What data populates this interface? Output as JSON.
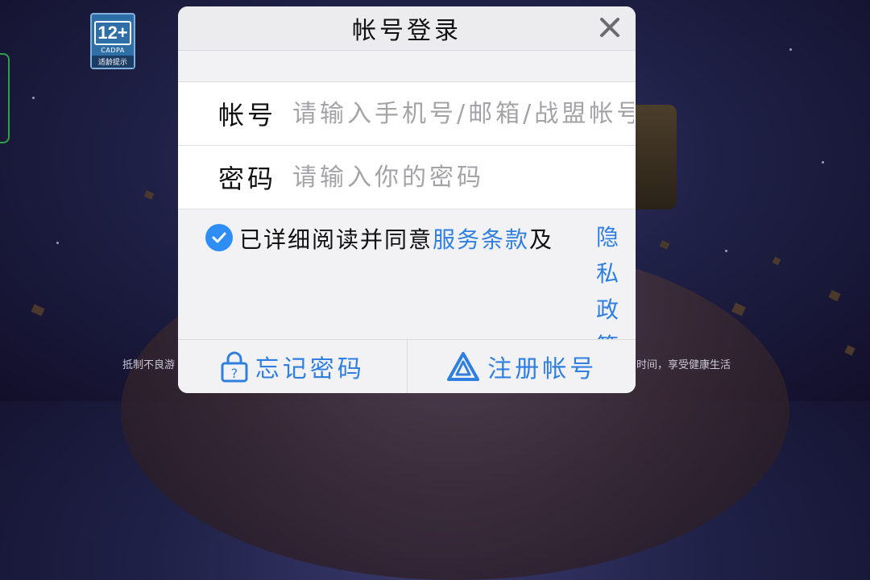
{
  "age_rating": {
    "number": "12+",
    "org": "CADPA",
    "tip": "适龄提示"
  },
  "background_notice": {
    "left": "抵制不良游",
    "right": "时间，享受健康生活"
  },
  "dialog": {
    "title": "帐号登录",
    "account": {
      "label": "帐号",
      "placeholder": "请输入手机号/邮箱/战盟帐号",
      "value": ""
    },
    "password": {
      "label": "密码",
      "placeholder": "请输入你的密码",
      "value": ""
    },
    "agreement": {
      "checked": true,
      "prefix": "已详细阅读并同意",
      "terms_link": "服务条款",
      "connector": "及",
      "privacy_link": "隐私政策"
    },
    "forgot_password": "忘记密码",
    "register": "注册帐号"
  },
  "colors": {
    "accent": "#2f7fe0",
    "check": "#2f8ef5",
    "badge": "#2f6fa8"
  },
  "icons": [
    "close-icon",
    "checkmark-icon",
    "lock-question-icon",
    "register-logo-icon"
  ]
}
